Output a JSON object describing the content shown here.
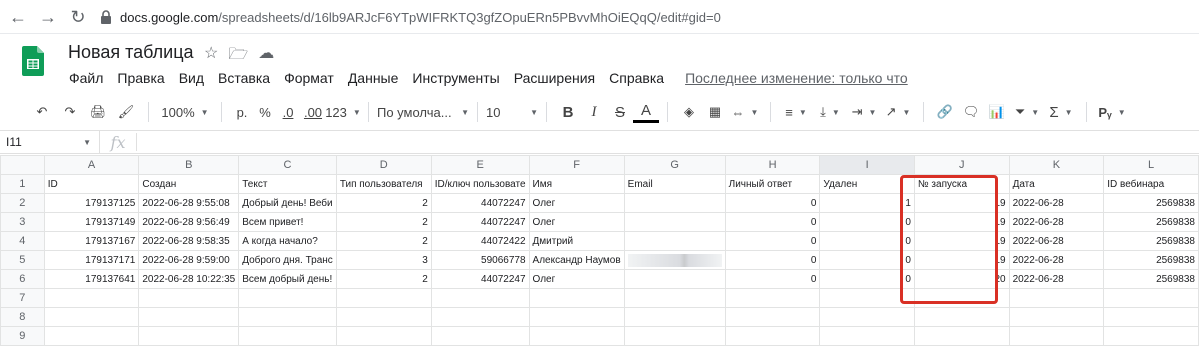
{
  "browser": {
    "url_domain": "docs.google.com",
    "url_path": "/spreadsheets/d/16lb9ARJcF6YTpWIFRKTQ3gfZOpuERn5PBvvMhOiEQqQ/edit#gid=0"
  },
  "doc": {
    "title": "Новая таблица"
  },
  "menu": {
    "items": [
      "Файл",
      "Правка",
      "Вид",
      "Вставка",
      "Формат",
      "Данные",
      "Инструменты",
      "Расширения",
      "Справка"
    ],
    "last_edit": "Последнее изменение: только что"
  },
  "toolbar": {
    "zoom": "100%",
    "currency": "р.",
    "percent": "%",
    "dec_less": ".0",
    "dec_more": ".00",
    "format_more": "123",
    "font": "По умолча...",
    "font_size": "10",
    "bold": "B",
    "italic": "I",
    "strike": "S",
    "text_color": "A",
    "sum": "Σ"
  },
  "formula_bar": {
    "cell_ref": "I11",
    "fx": "fx"
  },
  "sheet": {
    "columns": [
      "A",
      "B",
      "C",
      "D",
      "E",
      "F",
      "G",
      "H",
      "I",
      "J",
      "K",
      "L"
    ],
    "rows": [
      [
        "1",
        "ID",
        "Создан",
        "Текст",
        "Тип пользователя",
        "ID/ключ пользовате",
        "Имя",
        "Email",
        "Личный ответ",
        "Удален",
        "№ запуска",
        "Дата",
        "ID вебинара"
      ],
      [
        "2",
        "179137125",
        "2022-06-28 9:55:08",
        "Добрый день! Веби",
        "2",
        "44072247",
        "Олег",
        "",
        "0",
        "1",
        "19",
        "2022-06-28",
        "2569838"
      ],
      [
        "3",
        "179137149",
        "2022-06-28 9:56:49",
        "Всем привет!",
        "2",
        "44072247",
        "Олег",
        "",
        "0",
        "0",
        "19",
        "2022-06-28",
        "2569838"
      ],
      [
        "4",
        "179137167",
        "2022-06-28 9:58:35",
        "А когда начало?",
        "2",
        "44072422",
        "Дмитрий",
        "",
        "0",
        "0",
        "19",
        "2022-06-28",
        "2569838"
      ],
      [
        "5",
        "179137171",
        "2022-06-28 9:59:00",
        "Доброго дня. Транс",
        "3",
        "59066778",
        "Александр Наумов",
        "",
        "0",
        "0",
        "19",
        "2022-06-28",
        "2569838"
      ],
      [
        "6",
        "179137641",
        "2022-06-28 10:22:35",
        "Всем добрый день!",
        "2",
        "44072247",
        "Олег",
        "",
        "0",
        "0",
        "20",
        "2022-06-28",
        "2569838"
      ],
      [
        "7",
        "",
        "",
        "",
        "",
        "",
        "",
        "",
        "",
        "",
        "",
        "",
        ""
      ],
      [
        "8",
        "",
        "",
        "",
        "",
        "",
        "",
        "",
        "",
        "",
        "",
        "",
        ""
      ],
      [
        "9",
        "",
        "",
        "",
        "",
        "",
        "",
        "",
        "",
        "",
        "",
        "",
        ""
      ]
    ]
  },
  "colors": {
    "highlight": "#d93025",
    "sheets_green": "#0f9d58"
  }
}
